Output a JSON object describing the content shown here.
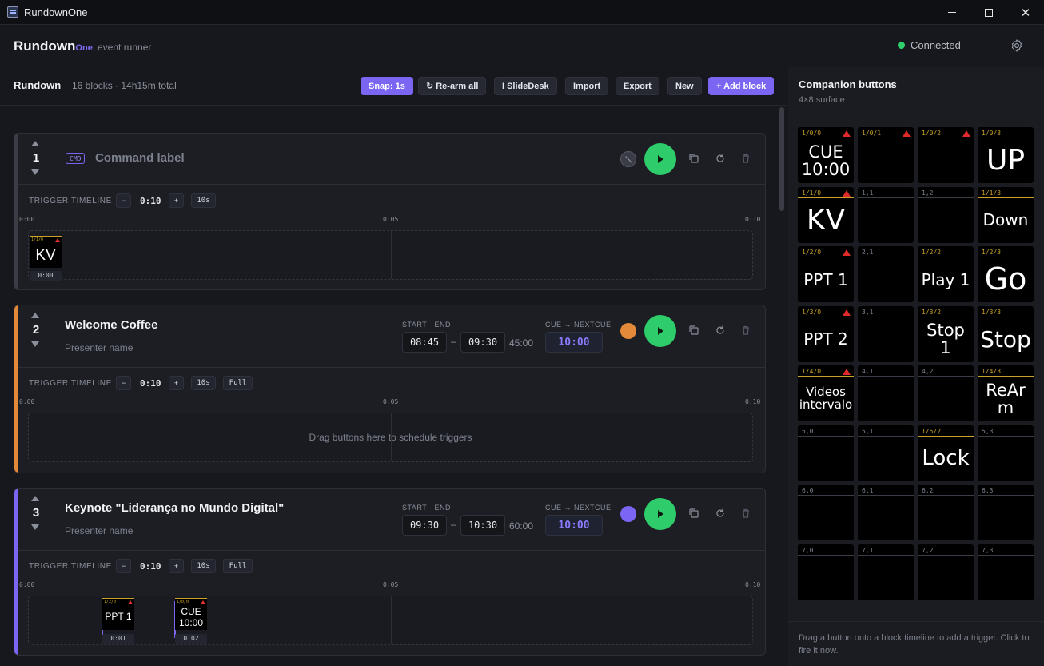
{
  "window": {
    "title": "RundownOne"
  },
  "header": {
    "brand": "Rundown",
    "brand_suffix": "One",
    "tagline": "event runner",
    "status": "Connected",
    "status_color": "#2fd06a"
  },
  "rundown": {
    "title": "Rundown",
    "summary": "16 blocks · 14h15m total",
    "toolbar": {
      "snap": "Snap: 1s",
      "rearm": "Re-arm all",
      "slidedesk": "SlideDesk",
      "import": "Import",
      "export": "Export",
      "new": "New",
      "add_block": "+ Add block"
    }
  },
  "labels": {
    "start_end": "START · END",
    "cue_next": "CUE → NEXTCUE",
    "trigger_timeline": "TRIGGER TIMELINE",
    "minus": "−",
    "plus": "+",
    "ten_s": "10s",
    "full": "Full",
    "dash": "–",
    "drop_hint": "Drag buttons here to schedule triggers"
  },
  "blocks": [
    {
      "number": "1",
      "type_badge": "CMD",
      "title": "Command label",
      "color": "#7c818d",
      "trigger_duration": "0:10",
      "ticks": [
        "0:00",
        "0:05",
        "0:10"
      ],
      "triggers": [
        {
          "id": "1/1/0",
          "label": "KV",
          "time": "0:00"
        }
      ]
    },
    {
      "number": "2",
      "title": "Welcome Coffee",
      "presenter": "Presenter name",
      "start": "08:45",
      "end": "09:30",
      "duration": "45:00",
      "cue": "10:00",
      "color": "#e38a3a",
      "trigger_duration": "0:10",
      "ticks": [
        "0:00",
        "0:05",
        "0:10"
      ],
      "triggers": []
    },
    {
      "number": "3",
      "title": "Keynote \"Liderança no Mundo Digital\"",
      "presenter": "Presenter name",
      "start": "09:30",
      "end": "10:30",
      "duration": "60:00",
      "cue": "10:00",
      "color": "#7a66f3",
      "trigger_duration": "0:10",
      "ticks": [
        "0:00",
        "0:05",
        "0:10"
      ],
      "triggers": [
        {
          "id": "1/2/0",
          "label": "PPT 1",
          "time": "0:01"
        },
        {
          "id": "1/0/0",
          "label": "CUE 10:00",
          "time": "0:02"
        }
      ]
    }
  ],
  "companion": {
    "title": "Companion buttons",
    "subtitle": "4×8 surface",
    "footer": "Drag a button onto a block timeline to add a trigger. Click to fire it now.",
    "keys": [
      [
        "1/0/0",
        "CUE\n10:00",
        true,
        true
      ],
      [
        "1/0/1",
        "",
        true,
        true
      ],
      [
        "1/0/2",
        "",
        true,
        true
      ],
      [
        "1/0/3",
        "UP",
        true,
        false
      ],
      [
        "1/1/0",
        "KV",
        true,
        true
      ],
      [
        "1,1",
        "",
        false,
        false
      ],
      [
        "1,2",
        "",
        false,
        false
      ],
      [
        "1/1/3",
        "Down",
        true,
        false
      ],
      [
        "1/2/0",
        "PPT 1",
        true,
        true
      ],
      [
        "2,1",
        "",
        false,
        false
      ],
      [
        "1/2/2",
        "Play 1",
        true,
        false
      ],
      [
        "1/2/3",
        "Go",
        true,
        false
      ],
      [
        "1/3/0",
        "PPT 2",
        true,
        true
      ],
      [
        "3,1",
        "",
        false,
        false
      ],
      [
        "1/3/2",
        "Stop\n1",
        true,
        false
      ],
      [
        "1/3/3",
        "Stop",
        true,
        false
      ],
      [
        "1/4/0",
        "Videos\nintervalo",
        true,
        true
      ],
      [
        "4,1",
        "",
        false,
        false
      ],
      [
        "4,2",
        "",
        false,
        false
      ],
      [
        "1/4/3",
        "ReAr\nm",
        true,
        false
      ],
      [
        "5,0",
        "",
        false,
        false
      ],
      [
        "5,1",
        "",
        false,
        false
      ],
      [
        "1/5/2",
        "Lock",
        true,
        false
      ],
      [
        "5,3",
        "",
        false,
        false
      ],
      [
        "6,0",
        "",
        false,
        false
      ],
      [
        "6,1",
        "",
        false,
        false
      ],
      [
        "6,2",
        "",
        false,
        false
      ],
      [
        "6,3",
        "",
        false,
        false
      ],
      [
        "7,0",
        "",
        false,
        false
      ],
      [
        "7,1",
        "",
        false,
        false
      ],
      [
        "7,2",
        "",
        false,
        false
      ],
      [
        "7,3",
        "",
        false,
        false
      ]
    ]
  }
}
